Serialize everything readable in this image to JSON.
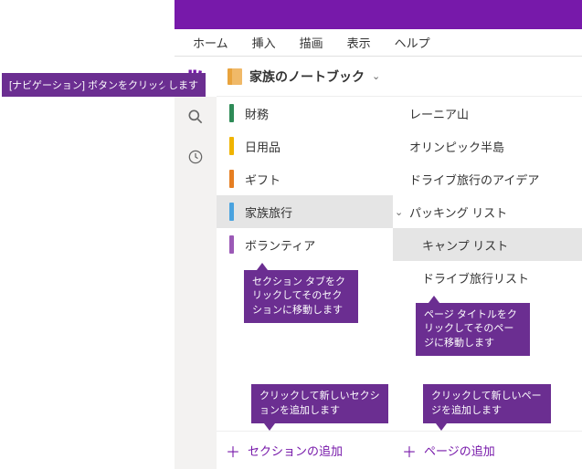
{
  "callouts": {
    "nav_button": "[ナビゲーション] ボタンをクリックします",
    "section_tab": "セクション タブをクリックしてそのセクションに移動します",
    "page_title": "ページ タイトルをクリックしてそのページに移動します",
    "add_section": "クリックして新しいセクションを追加します",
    "add_page": "クリックして新しいページを追加します"
  },
  "menu": {
    "home": "ホーム",
    "insert": "挿入",
    "draw": "描画",
    "view": "表示",
    "help": "ヘルプ"
  },
  "notebook": {
    "title": "家族のノートブック"
  },
  "sections": [
    {
      "label": "財務",
      "color": "#2e8b57"
    },
    {
      "label": "日用品",
      "color": "#f0b400"
    },
    {
      "label": "ギフト",
      "color": "#e67e22"
    },
    {
      "label": "家族旅行",
      "color": "#4aa3df"
    },
    {
      "label": "ボランティア",
      "color": "#9b59b6"
    }
  ],
  "pages": [
    {
      "label": "レーニア山"
    },
    {
      "label": "オリンピック半島"
    },
    {
      "label": "ドライブ旅行のアイデア"
    },
    {
      "label": "パッキング リスト",
      "expandable": true
    },
    {
      "label": "キャンプ リスト",
      "sub": true,
      "selected": true
    },
    {
      "label": "ドライブ旅行リスト",
      "sub": true
    }
  ],
  "add": {
    "section": "セクションの追加",
    "page": "ページの追加"
  }
}
